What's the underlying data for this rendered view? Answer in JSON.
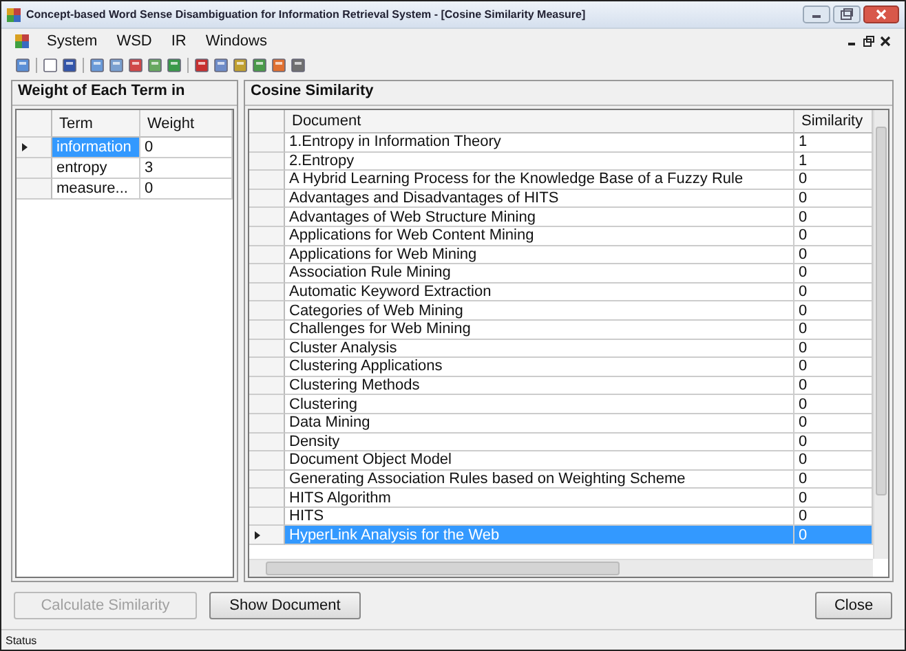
{
  "window": {
    "title": "Concept-based Word Sense Disambiguation for Information Retrieval System - [Cosine Similarity Measure]"
  },
  "menu": [
    "System",
    "WSD",
    "IR",
    "Windows"
  ],
  "terms_panel": {
    "title": "Weight of Each Term in",
    "columns": [
      "Term",
      "Weight"
    ],
    "rows": [
      {
        "term": "information",
        "weight": "0",
        "selected": true
      },
      {
        "term": "entropy",
        "weight": "3",
        "selected": false
      },
      {
        "term": "measure...",
        "weight": "0",
        "selected": false
      }
    ]
  },
  "similarity_panel": {
    "title": "Cosine Similarity",
    "columns": [
      "Document",
      "Similarity"
    ],
    "rows": [
      {
        "document": "1.Entropy in Information Theory",
        "similarity": "1",
        "selected": false
      },
      {
        "document": "2.Entropy",
        "similarity": "1",
        "selected": false
      },
      {
        "document": "A Hybrid Learning Process for the Knowledge Base of a Fuzzy Rule",
        "similarity": "0",
        "selected": false
      },
      {
        "document": "Advantages and Disadvantages of HITS",
        "similarity": "0",
        "selected": false
      },
      {
        "document": "Advantages of Web Structure Mining",
        "similarity": "0",
        "selected": false
      },
      {
        "document": "Applications for Web Content Mining",
        "similarity": "0",
        "selected": false
      },
      {
        "document": "Applications for Web Mining",
        "similarity": "0",
        "selected": false
      },
      {
        "document": "Association Rule Mining",
        "similarity": "0",
        "selected": false
      },
      {
        "document": "Automatic Keyword Extraction",
        "similarity": "0",
        "selected": false
      },
      {
        "document": "Categories of Web Mining",
        "similarity": "0",
        "selected": false
      },
      {
        "document": "Challenges for Web Mining",
        "similarity": "0",
        "selected": false
      },
      {
        "document": "Cluster Analysis",
        "similarity": "0",
        "selected": false
      },
      {
        "document": "Clustering Applications",
        "similarity": "0",
        "selected": false
      },
      {
        "document": "Clustering Methods",
        "similarity": "0",
        "selected": false
      },
      {
        "document": "Clustering",
        "similarity": "0",
        "selected": false
      },
      {
        "document": "Data Mining",
        "similarity": "0",
        "selected": false
      },
      {
        "document": "Density",
        "similarity": "0",
        "selected": false
      },
      {
        "document": "Document Object Model",
        "similarity": "0",
        "selected": false
      },
      {
        "document": "Generating Association Rules based on Weighting Scheme",
        "similarity": "0",
        "selected": false
      },
      {
        "document": "HITS Algorithm",
        "similarity": "0",
        "selected": false
      },
      {
        "document": "HITS",
        "similarity": "0",
        "selected": false
      },
      {
        "document": "HyperLink Analysis for the Web",
        "similarity": "0",
        "selected": true
      }
    ]
  },
  "buttons": [
    {
      "label": "Calculate Similarity",
      "disabled": true
    },
    {
      "label": "Show Document",
      "disabled": false
    },
    {
      "label": "Close",
      "disabled": false
    }
  ],
  "status_bar": {
    "text": "Status"
  }
}
